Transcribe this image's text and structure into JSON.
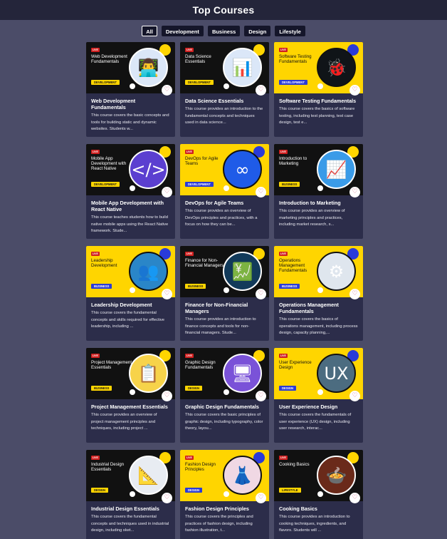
{
  "header": {
    "title": "Top Courses"
  },
  "filters": [
    {
      "label": "All",
      "active": true
    },
    {
      "label": "Development",
      "active": false
    },
    {
      "label": "Business",
      "active": false
    },
    {
      "label": "Design",
      "active": false
    },
    {
      "label": "Lifestyle",
      "active": false
    }
  ],
  "live_badge": "LIVE",
  "courses": [
    {
      "thumb_title": "Web Development Fundamentals",
      "tag": "DEVELOPMENT",
      "theme": "black",
      "icon": "developer-laptop-icon",
      "glyph": "👨‍💻",
      "circle_bg": "#dbe7f8",
      "title": "Web Development Fundamentals",
      "description": "This course covers the basic concepts and tools for building static and dynamic websites. Students w..."
    },
    {
      "thumb_title": "Data Science Essentials",
      "tag": "DEVELOPMENT",
      "theme": "black",
      "icon": "data-analyst-icon",
      "glyph": "📊",
      "circle_bg": "#dbe7f8",
      "title": "Data Science Essentials",
      "description": "This course provides an introduction to the fundamental concepts and techniques used in data science..."
    },
    {
      "thumb_title": "Software Testing Fundamentals",
      "tag": "DEVELOPMENT",
      "theme": "yellow",
      "icon": "bug-icon",
      "glyph": "🐞",
      "circle_bg": "#101418",
      "title": "Software Testing Fundamentals",
      "description": "This course covers the basics of software testing, including test planning, test case design, test e..."
    },
    {
      "thumb_title": "Mobile App Development with React Native",
      "tag": "DEVELOPMENT",
      "theme": "black",
      "icon": "code-brackets-icon",
      "glyph": "</>",
      "circle_bg": "#5b3fd0",
      "title": "Mobile App Development with React Native",
      "description": "This course teaches students how to build native mobile apps using the React Native framework. Stude..."
    },
    {
      "thumb_title": "DevOps for Agile Teams",
      "tag": "DEVELOPMENT",
      "theme": "yellow",
      "icon": "infinity-loop-icon",
      "glyph": "∞",
      "circle_bg": "#1f5be8",
      "title": "DevOps for Agile Teams",
      "description": "This course provides an overview of DevOps principles and practices, with a focus on how they can be..."
    },
    {
      "thumb_title": "Introduction to Marketing",
      "tag": "BUSINESS",
      "theme": "black",
      "icon": "marketing-dashboard-icon",
      "glyph": "📈",
      "circle_bg": "#3a9be8",
      "title": "Introduction to Marketing",
      "description": "This course provides an overview of marketing principles and practices, including market research, s..."
    },
    {
      "thumb_title": "Leadership Development",
      "tag": "BUSINESS",
      "theme": "yellow",
      "icon": "leader-crowd-icon",
      "glyph": "👥",
      "circle_bg": "#2a86c8",
      "title": "Leadership Development",
      "description": "This course covers the fundamental concepts and skills required for effective leadership, including ..."
    },
    {
      "thumb_title": "Finance for Non-Financial Managers",
      "tag": "BUSINESS",
      "theme": "black",
      "icon": "finance-chart-icon",
      "glyph": "💹",
      "circle_bg": "#123a5a",
      "title": "Finance for Non-Financial Managers",
      "description": "This course provides an introduction to finance concepts and tools for non-financial managers. Stude..."
    },
    {
      "thumb_title": "Operations Management Fundamentals",
      "tag": "BUSINESS",
      "theme": "yellow",
      "icon": "operations-gears-icon",
      "glyph": "⚙",
      "circle_bg": "#dfe6ee",
      "title": "Operations Management Fundamentals",
      "description": "This course covers the basics of operations management, including process design, capacity planning,..."
    },
    {
      "thumb_title": "Project Management Essentials",
      "tag": "BUSINESS",
      "theme": "black",
      "icon": "project-board-icon",
      "glyph": "📋",
      "circle_bg": "#f7d34a",
      "title": "Project Management Essentials",
      "description": "This course provides an overview of project management principles and techniques, including project ..."
    },
    {
      "thumb_title": "Graphic Design Fundamentals",
      "tag": "DESIGN",
      "theme": "black",
      "icon": "design-monitor-icon",
      "glyph": "🖥",
      "circle_bg": "#7a52d8",
      "title": "Graphic Design Fundamentals",
      "description": "This course covers the basic principles of graphic design, including typography, color theory, layou..."
    },
    {
      "thumb_title": "User Experience Design",
      "tag": "DESIGN",
      "theme": "yellow",
      "icon": "ux-letters-icon",
      "glyph": "UX",
      "circle_bg": "#4c6c80",
      "title": "User Experience Design",
      "description": "This course covers the fundamentals of user experience (UX) design, including user research, interac..."
    },
    {
      "thumb_title": "Industrial Design Essentials",
      "tag": "DESIGN",
      "theme": "black",
      "icon": "blueprint-icon",
      "glyph": "📐",
      "circle_bg": "#e8ecf2",
      "title": "Industrial Design Essentials",
      "description": "This course covers the fundamental concepts and techniques used in industrial design, including sket..."
    },
    {
      "thumb_title": "Fashion Design Principles",
      "tag": "DESIGN",
      "theme": "yellow",
      "icon": "fashion-sketch-icon",
      "glyph": "👗",
      "circle_bg": "#f0d8e4",
      "title": "Fashion Design Principles",
      "description": "This course covers the principles and practices of fashion design, including fashion illustration, t..."
    },
    {
      "thumb_title": "Cooking Basics",
      "tag": "LIFESTYLE",
      "theme": "black",
      "icon": "cooking-pot-icon",
      "glyph": "🍲",
      "circle_bg": "#6a2a1a",
      "title": "Cooking Basics",
      "description": "This course provides an introduction to cooking techniques, ingredients, and flavors. Students will ..."
    }
  ]
}
